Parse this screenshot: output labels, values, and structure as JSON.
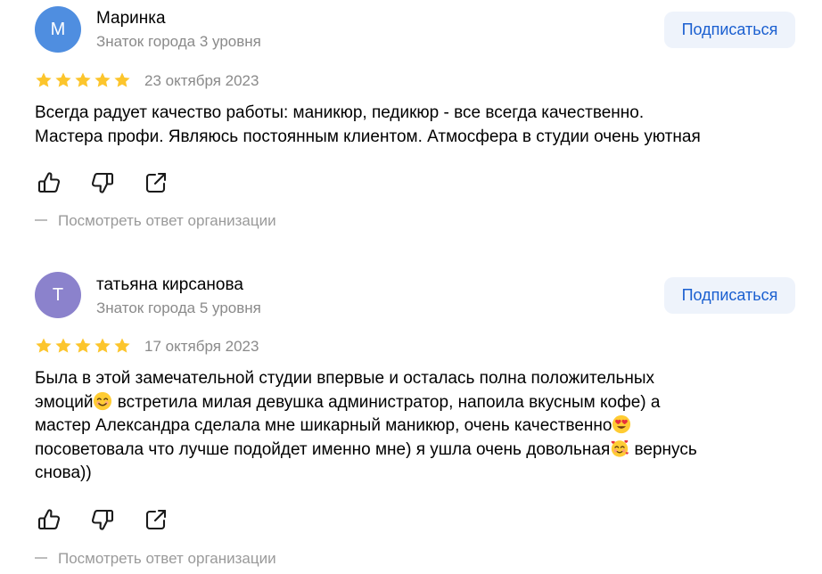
{
  "colors": {
    "avatar_1": "#4f8ee0",
    "avatar_2": "#8b82cc",
    "star": "#fcc52c",
    "subscribe_bg": "#eef3fb",
    "subscribe_text": "#1a5fd0",
    "muted_text": "#8a8a8a"
  },
  "reviews": [
    {
      "avatar_letter": "М",
      "author": "Маринка",
      "level": "Знаток города 3 уровня",
      "subscribe_label": "Подписаться",
      "rating": 5,
      "date": "23 октября 2023",
      "text_lines": [
        "Всегда радует качество работы: маникюр, педикюр - все всегда качественно.",
        "Мастера профи. Являюсь постоянным клиентом. Атмосфера в студии очень уютная"
      ],
      "actions": [
        "thumbs-up-icon",
        "thumbs-down-icon",
        "share-icon"
      ],
      "org_reply_label": "Посмотреть ответ организации"
    },
    {
      "avatar_letter": "Т",
      "author": "татьяна кирсанова",
      "level": "Знаток города 5 уровня",
      "subscribe_label": "Подписаться",
      "rating": 5,
      "date": "17 октября 2023",
      "text_parts": {
        "l1": "Была в этой замечательной студии впервые и осталась полна положительных",
        "l2a": "эмоций",
        "l2b": " встретила милая девушка администратор, напоила вкусным кофе) а",
        "l3a": "мастер Александра сделала мне шикарный маникюр, очень качественно",
        "l4a": "посоветовала что лучше подойдет именно мне) я ушла очень довольная",
        "l4b": " вернусь",
        "l5": "снова))"
      },
      "emojis": [
        "smiling-face-emoji",
        "heart-eyes-emoji",
        "smiling-face-with-hearts-emoji"
      ],
      "actions": [
        "thumbs-up-icon",
        "thumbs-down-icon",
        "share-icon"
      ],
      "org_reply_label": "Посмотреть ответ организации"
    }
  ]
}
